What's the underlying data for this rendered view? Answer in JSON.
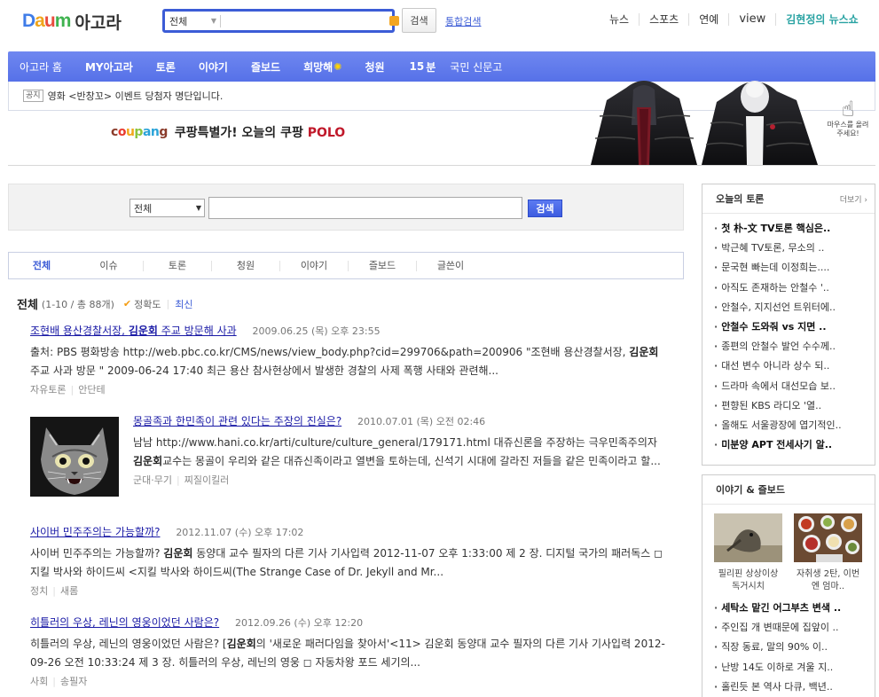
{
  "header": {
    "logo_letters": [
      "D",
      "a",
      "u",
      "m"
    ],
    "logo_colors": [
      "#3f7ce8",
      "#f0a51b",
      "#e84c3d",
      "#3fb34f"
    ],
    "logo_sub": "아고라",
    "search_scope": "전체",
    "search_value": "",
    "search_button": "검색",
    "total_search_link": "통합검색",
    "gnb": [
      "뉴스",
      "스포츠",
      "연예",
      "view",
      "김현정의 뉴스쇼"
    ]
  },
  "nav": {
    "items": [
      "아고라 홈",
      "MY아고라",
      "토론",
      "이야기",
      "즐보드",
      "희망해",
      "청원",
      "15",
      "국민 신문고"
    ],
    "num_suffix": "분",
    "accent": "#5671e8"
  },
  "notice": {
    "tag": "공지",
    "text": "영화 <반창꼬> 이벤트 당첨자 명단입니다."
  },
  "ad": {
    "brand_letters": [
      "c",
      "o",
      "u",
      "p",
      "a",
      "n",
      "g"
    ],
    "brand_colors": [
      "#8a3b2a",
      "#e8392e",
      "#f2a71b",
      "#8cc53f",
      "#2aa3d8",
      "#2aa3d8",
      "#8a3b2a"
    ],
    "text": "쿠팡특별가! 오늘의 쿠팡",
    "brand_word": "POLO",
    "hover_hint": "마우스를 올려주세요!"
  },
  "main_search": {
    "scope": "전체",
    "value": "",
    "button": "검색"
  },
  "tabs": [
    "전체",
    "이슈",
    "토론",
    "청원",
    "이야기",
    "즐보드",
    "글쓴이"
  ],
  "results_header": {
    "title": "전체",
    "range": "(1-10 / 총 88개)",
    "sort_accuracy": "정확도",
    "sort_latest": "최신"
  },
  "results": [
    {
      "title_pre": "조현배 용산경찰서장, ",
      "title_hl": "김운회",
      "title_post": " 주교 방문해 사과",
      "date": "2009.06.25 (목) 오후 23:55",
      "body_pre": "출처: PBS 평화방송 http://web.pbc.co.kr/CMS/news/view_body.php?cid=299706&path=200906 \"조현배 용산경찰서장, ",
      "body_hl": "김운회",
      "body_post": " 주교 사과 방문 \" 2009-06-24 17:40 최근 용산 참사현상에서 발생한 경찰의 사제 폭행 사태와 관련해...",
      "cat1": "자유토론",
      "cat2": "안단테"
    },
    {
      "title_pre": "몽골족과 한민족이 관련 있다는 주장의 진실은?",
      "title_hl": "",
      "title_post": "",
      "date": "2010.07.01 (목) 오전 02:46",
      "body_pre": "남남 http://www.hani.co.kr/arti/culture/culture_general/179171.html 대쥬신론을 주장하는 극우민족주의자 ",
      "body_hl": "김운회",
      "body_post": "교수는 몽골이 우리와 같은 대쥬신족이라고 열변을 토하는데, 신석기 시대에 갈라진 저들을 같은 민족이라고 할...",
      "cat1": "군대·무기",
      "cat2": "찌질이킬러"
    },
    {
      "title_pre": "사이버 민주주의는 가능할까?",
      "title_hl": "",
      "title_post": "",
      "date": "2012.11.07 (수) 오후 17:02",
      "body_pre": "사이버 민주주의는 가능할까? ",
      "body_hl": "김운회",
      "body_post": " 동양대 교수 필자의 다른 기사 기사입력 2012-11-07 오후 1:33:00 제 2 장. 디지털 국가의 패러독스 ◻ 지킬 박사와 하이드씨 <지킬 박사와 하이드씨(The Strange Case of Dr. Jekyll and Mr...",
      "cat1": "정치",
      "cat2": "새롬"
    },
    {
      "title_pre": "히틀러의 우상, 레닌의 영웅이었던 사람은?",
      "title_hl": "",
      "title_post": "",
      "date": "2012.09.26 (수) 오후 12:20",
      "body_pre": "히틀러의 우상, 레닌의 영웅이었던 사람은? [",
      "body_hl": "김운회",
      "body_post": "의 '새로운 패러다임을 찾아서'<11> 김운회 동양대 교수 필자의 다른 기사 기사입력 2012-09-26 오전 10:33:24 제 3 장. 히틀러의 우상, 레닌의 영웅 ◻ 자동차왕 포드 세기의...",
      "cat1": "사회",
      "cat2": "송필자"
    }
  ],
  "sidebar": {
    "debate": {
      "title": "오늘의 토론",
      "more": "더보기 ›",
      "items": [
        {
          "text": "첫 朴-文 TV토론 핵심은..",
          "bold": true
        },
        {
          "text": "박근혜 TV토론, 무소의 ..",
          "bold": false
        },
        {
          "text": "문국현 빠는데 이정희는....",
          "bold": false
        },
        {
          "text": "아직도 존재하는 안철수 '..",
          "bold": false
        },
        {
          "text": "안철수, 지지선언 트위터에..",
          "bold": false
        },
        {
          "text": "안철수 도와줘 vs 지면 ..",
          "bold": true
        },
        {
          "text": "종편의 안철수 발언 수수께..",
          "bold": false
        },
        {
          "text": "대선 변수 아니라 상수 되..",
          "bold": false
        },
        {
          "text": "드라마 속에서 대선모습 보..",
          "bold": false
        },
        {
          "text": "편향된 KBS 라디오 '열..",
          "bold": false
        },
        {
          "text": "올해도 서울광장에 엽기적인..",
          "bold": false
        },
        {
          "text": "미분양 APT 전세사기 알..",
          "bold": true
        }
      ]
    },
    "story": {
      "title": "이야기 & 즐보드",
      "photos": [
        {
          "caption_l1": "필리핀 상상이상",
          "caption_l2": "독거시치"
        },
        {
          "caption_l1": "자취생 2탄, 이번",
          "caption_l2": "엔 엄마.."
        }
      ],
      "items": [
        {
          "text": "세탁소 맡긴 어그부츠 변색 ..",
          "bold": true
        },
        {
          "text": "주인집 개 변때문에 집앞이 ..",
          "bold": false
        },
        {
          "text": "직장 동료, 말의 90% 이..",
          "bold": false
        },
        {
          "text": "난방 14도 이하로 겨울 지..",
          "bold": false
        },
        {
          "text": "홀린듯 본 역사 다큐, 백년..",
          "bold": false
        }
      ]
    }
  }
}
